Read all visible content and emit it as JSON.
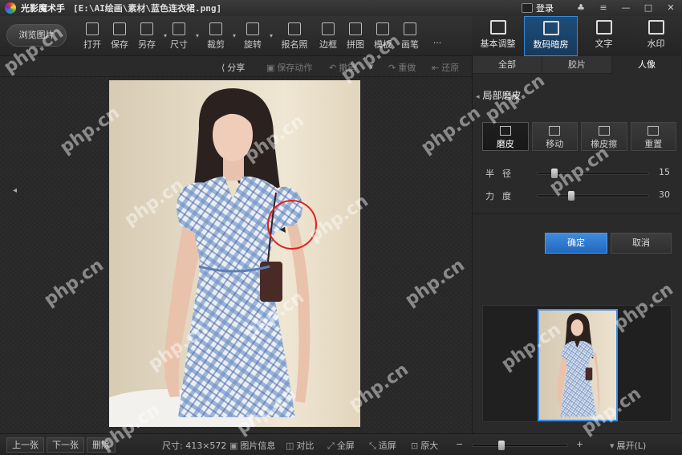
{
  "titlebar": {
    "app_name": "光影魔术手",
    "file_path": "[E:\\AI绘画\\素材\\蓝色连衣裙.png]",
    "login_label": "登录"
  },
  "toolbar": {
    "browse_label": "浏览图片",
    "tools": [
      {
        "icon": "open-icon",
        "label": "打开",
        "caret": false
      },
      {
        "icon": "save-icon",
        "label": "保存",
        "caret": false
      },
      {
        "icon": "save-as-icon",
        "label": "另存",
        "caret": true
      },
      {
        "icon": "size-icon",
        "label": "尺寸",
        "caret": true
      },
      {
        "icon": "crop-icon",
        "label": "裁剪",
        "caret": true
      },
      {
        "icon": "rotate-icon",
        "label": "旋转",
        "caret": true
      },
      {
        "icon": "id-photo-icon",
        "label": "报名照",
        "caret": false
      },
      {
        "icon": "border-icon",
        "label": "边框",
        "caret": false
      },
      {
        "icon": "collage-icon",
        "label": "拼图",
        "caret": false
      },
      {
        "icon": "template-icon",
        "label": "模板",
        "caret": false
      },
      {
        "icon": "brush-icon",
        "label": "画笔",
        "caret": false
      },
      {
        "icon": "more-icon",
        "label": "···",
        "caret": false
      }
    ]
  },
  "modes": [
    {
      "icon": "basic-adjust-icon",
      "label": "基本调整",
      "active": false
    },
    {
      "icon": "digital-darkroom-icon",
      "label": "数码暗房",
      "active": true
    },
    {
      "icon": "text-icon",
      "label": "文字",
      "active": false
    },
    {
      "icon": "watermark-icon",
      "label": "水印",
      "active": false
    }
  ],
  "subbar": {
    "share": "分享",
    "save_action": "保存动作",
    "undo": "撤销",
    "redo": "重做",
    "restore": "还原"
  },
  "rpanel": {
    "tabs": [
      "全部",
      "胶片",
      "人像"
    ],
    "active_tab": "人像",
    "section_title": "局部磨皮",
    "buttons": [
      {
        "label": "磨皮",
        "active": true
      },
      {
        "label": "移动",
        "active": false
      },
      {
        "label": "橡皮擦",
        "active": false
      },
      {
        "label": "重置",
        "active": false
      }
    ],
    "sliders": [
      {
        "label": "半径",
        "value": 15,
        "max": 100
      },
      {
        "label": "力度",
        "value": 30,
        "max": 100
      }
    ],
    "ok_label": "确定",
    "cancel_label": "取消"
  },
  "bottombar": {
    "prev": "上一张",
    "next": "下一张",
    "delete": "删除",
    "size_text": "尺寸: 413×572",
    "image_info": "图片信息",
    "compare": "对比",
    "fullscreen": "全屏",
    "fit": "适屏",
    "original": "原大",
    "zoom_minus": "−",
    "zoom_plus": "+",
    "expand": "展开(L)",
    "zoom_level": 0.3
  },
  "watermark": "php.cn"
}
